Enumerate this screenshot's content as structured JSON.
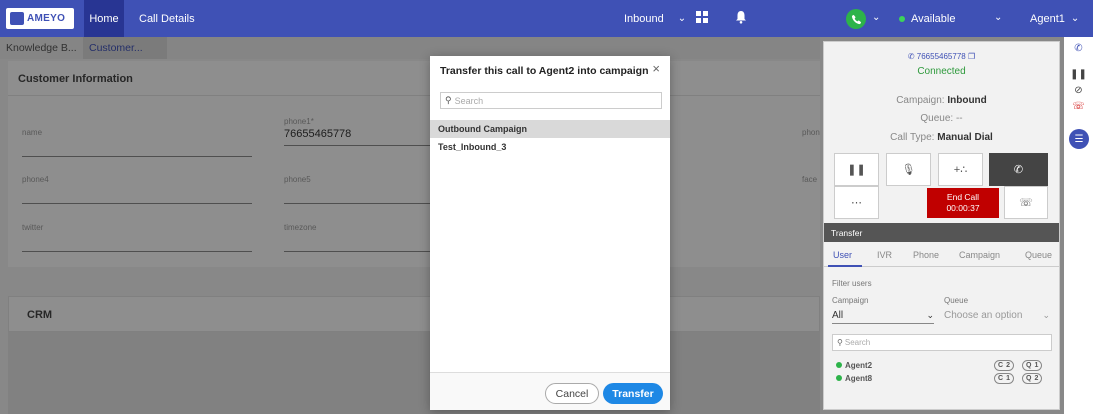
{
  "app": {
    "logo_text": "AMEYO",
    "nav": {
      "home": "Home",
      "call_details": "Call Details"
    },
    "campaign_select": "Inbound",
    "status": "Available",
    "agent": "Agent1",
    "accent": "#3f51b5"
  },
  "page": {
    "tabs": [
      "Knowledge B...",
      "Customer..."
    ],
    "section_title": "Customer Information",
    "fields": [
      {
        "label": "name",
        "value": ""
      },
      {
        "label": "phone1*",
        "value": "76655465778"
      },
      {
        "label": "phon",
        "value": ""
      },
      {
        "label": "phone4",
        "value": ""
      },
      {
        "label": "phone5",
        "value": ""
      },
      {
        "label": "face",
        "value": ""
      },
      {
        "label": "twitter",
        "value": ""
      },
      {
        "label": "timezone",
        "value": ""
      }
    ],
    "crm_title": "CRM"
  },
  "modal": {
    "title": "Transfer this call to Agent2 into campaign",
    "close": "×",
    "search_placeholder": "Search",
    "items": [
      "Outbound Campaign",
      "Test_Inbound_3"
    ],
    "cancel": "Cancel",
    "transfer": "Transfer"
  },
  "call_panel": {
    "number": "76655465778",
    "state": "Connected",
    "campaign_label": "Campaign:",
    "campaign_value": "Inbound",
    "queue_label": "Queue:",
    "queue_value": "--",
    "calltype_label": "Call Type:",
    "calltype_value": "Manual Dial",
    "end_call_label": "End Call",
    "end_call_timer": "00:00:37",
    "transfer_header": "Transfer",
    "transfer_tabs": [
      "User",
      "IVR",
      "Phone",
      "Campaign",
      "Queue"
    ],
    "filter_users": "Filter users",
    "campaign_filter_label": "Campaign",
    "campaign_filter_value": "All",
    "queue_filter_label": "Queue",
    "queue_filter_placeholder": "Choose an option",
    "search_placeholder": "Search",
    "agents": [
      {
        "name": "Agent2",
        "c": "2",
        "q": "1"
      },
      {
        "name": "Agent8",
        "c": "1",
        "q": "2"
      }
    ]
  }
}
